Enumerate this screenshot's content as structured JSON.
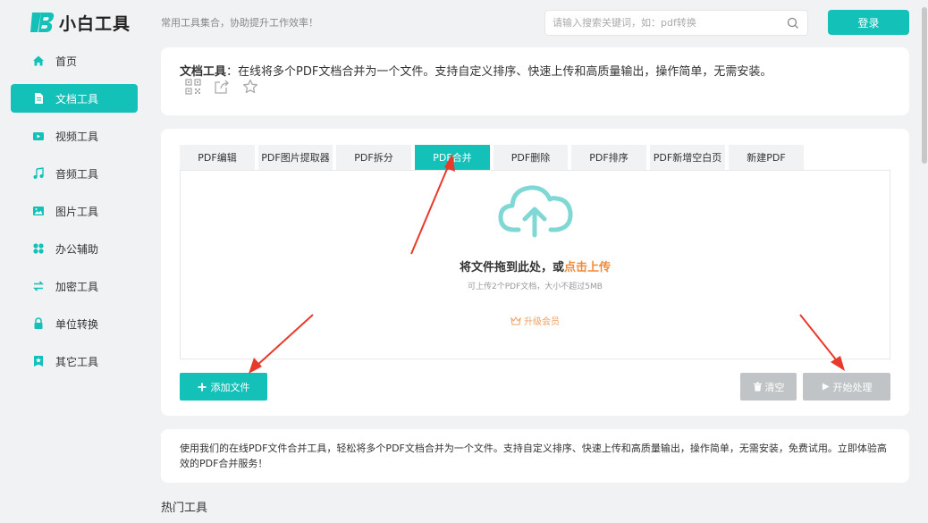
{
  "header": {
    "logo_text": "小白工具",
    "slogan": "常用工具集合，协助提升工作效率！",
    "search_placeholder": "请输入搜索关键词，如：pdf转换",
    "login_label": "登录"
  },
  "sidebar": {
    "items": [
      {
        "label": "首页",
        "icon": "home-icon"
      },
      {
        "label": "文档工具",
        "icon": "document-icon",
        "active": true
      },
      {
        "label": "视频工具",
        "icon": "video-icon"
      },
      {
        "label": "音频工具",
        "icon": "music-icon"
      },
      {
        "label": "图片工具",
        "icon": "image-icon"
      },
      {
        "label": "办公辅助",
        "icon": "grid-icon"
      },
      {
        "label": "加密工具",
        "icon": "swap-icon"
      },
      {
        "label": "单位转换",
        "icon": "lock-icon"
      },
      {
        "label": "其它工具",
        "icon": "star-badge-icon"
      }
    ]
  },
  "intro": {
    "title": "文档工具",
    "text": "：在线将多个PDF文档合并为一个文件。支持自定义排序、快速上传和高质量输出，操作简单，无需安装。"
  },
  "tabs": [
    {
      "label": "PDF编辑"
    },
    {
      "label": "PDF图片提取器"
    },
    {
      "label": "PDF拆分"
    },
    {
      "label": "PDF合并",
      "active": true
    },
    {
      "label": "PDF删除"
    },
    {
      "label": "PDF排序"
    },
    {
      "label": "PDF新增空白页"
    },
    {
      "label": "新建PDF"
    }
  ],
  "dropzone": {
    "title_prefix": "将文件拖到此处，或",
    "title_link": "点击上传",
    "subtitle": "可上传2个PDF文档，大小不超过5MB",
    "upgrade": "升级会员"
  },
  "actions": {
    "add_file": "添加文件",
    "clear": "清空",
    "start": "开始处理"
  },
  "description": "使用我们的在线PDF文件合并工具，轻松将多个PDF文档合并为一个文件。支持自定义排序、快速上传和高质量输出，操作简单，无需安装，免费试用。立即体验高效的PDF合并服务！",
  "hot_tools_title": "热门工具",
  "colors": {
    "accent": "#14c1b8",
    "link_orange": "#f08a3c",
    "disabled_button": "#c0c4c6",
    "annotation_arrow": "#e8392b"
  }
}
